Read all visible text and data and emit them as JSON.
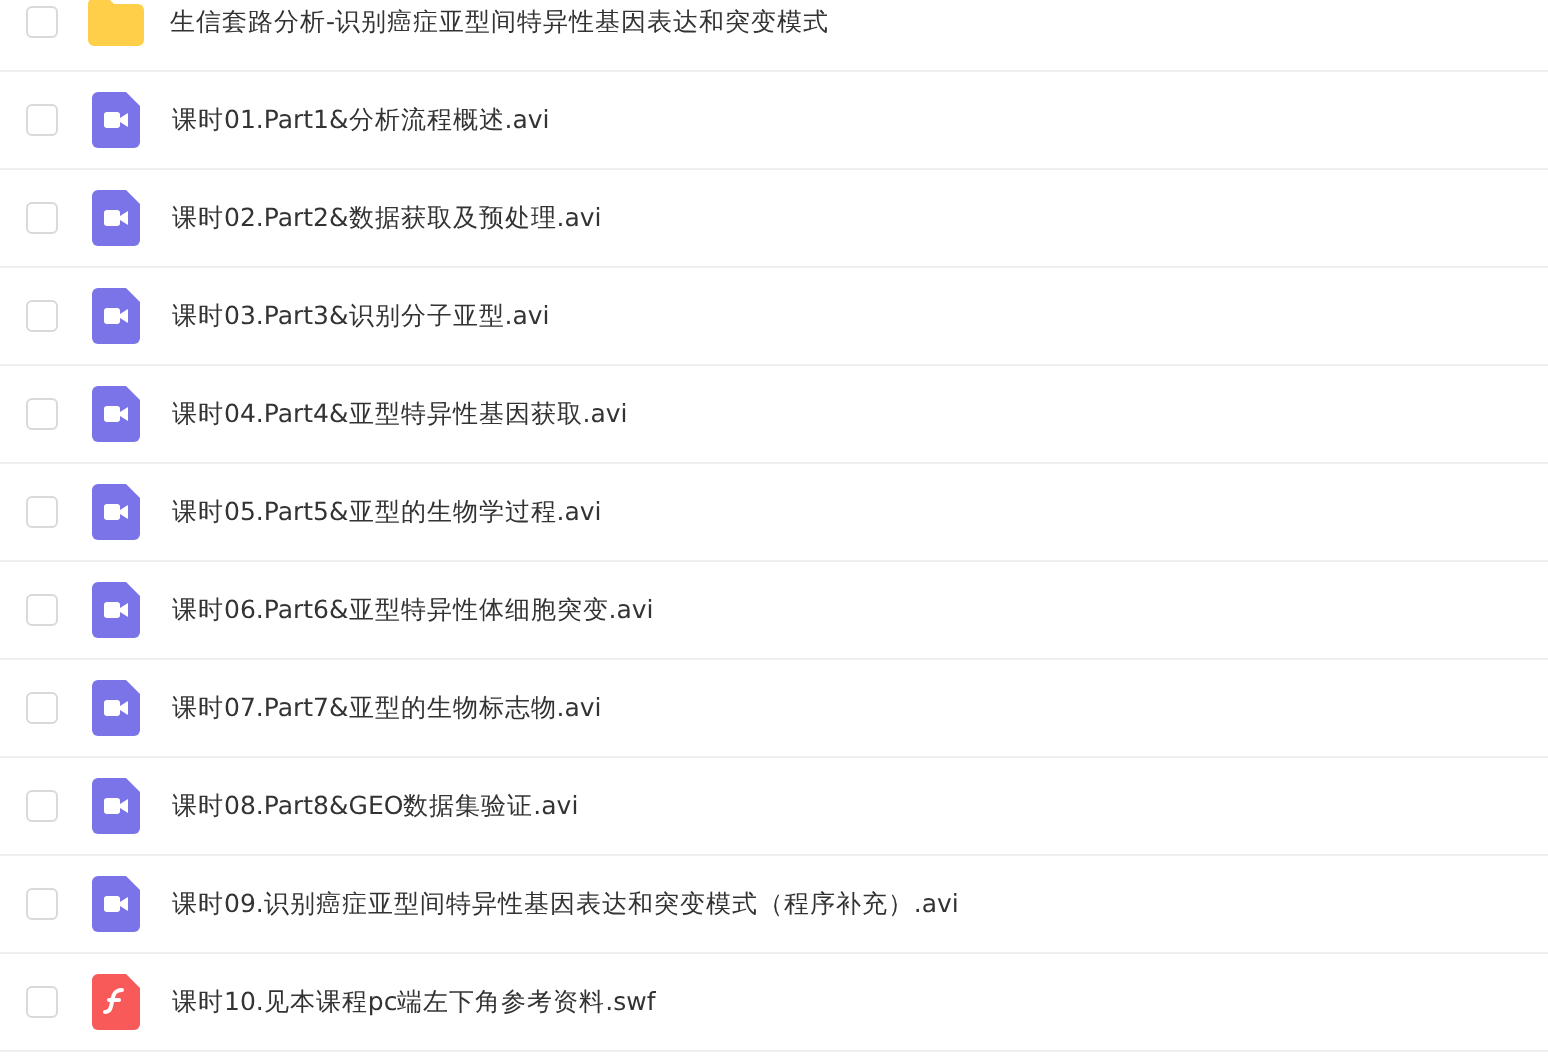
{
  "files": [
    {
      "kind": "folder",
      "name": "生信套路分析-识别癌症亚型间特异性基因表达和突变模式",
      "checked": false
    },
    {
      "kind": "video",
      "name": "课时01.Part1&分析流程概述.avi",
      "checked": false
    },
    {
      "kind": "video",
      "name": "课时02.Part2&数据获取及预处理.avi",
      "checked": false
    },
    {
      "kind": "video",
      "name": "课时03.Part3&识别分子亚型.avi",
      "checked": false
    },
    {
      "kind": "video",
      "name": "课时04.Part4&亚型特异性基因获取.avi",
      "checked": false
    },
    {
      "kind": "video",
      "name": "课时05.Part5&亚型的生物学过程.avi",
      "checked": false
    },
    {
      "kind": "video",
      "name": "课时06.Part6&亚型特异性体细胞突变.avi",
      "checked": false
    },
    {
      "kind": "video",
      "name": "课时07.Part7&亚型的生物标志物.avi",
      "checked": false
    },
    {
      "kind": "video",
      "name": "课时08.Part8&GEO数据集验证.avi",
      "checked": false
    },
    {
      "kind": "video",
      "name": "课时09.识别癌症亚型间特异性基因表达和突变模式（程序补充）.avi",
      "checked": false
    },
    {
      "kind": "flash",
      "name": "课时10.见本课程pc端左下角参考资料.swf",
      "checked": false
    }
  ]
}
